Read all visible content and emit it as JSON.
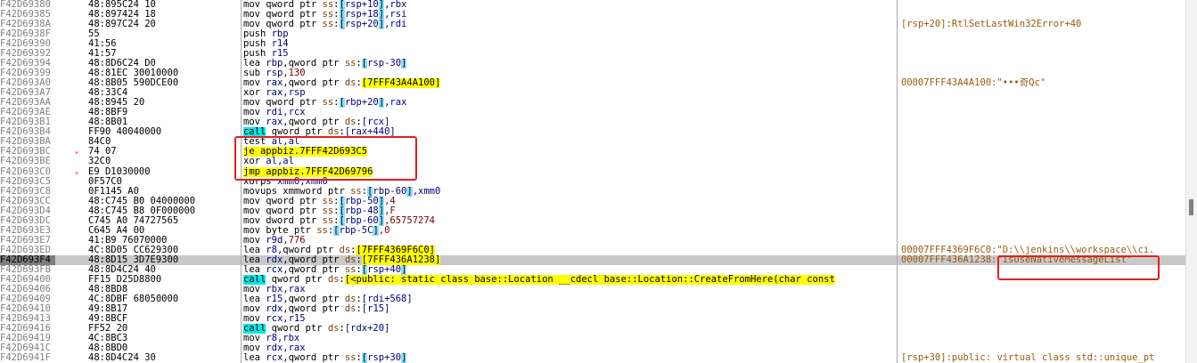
{
  "window": {
    "title": ""
  },
  "rows": [
    {
      "addr": "F42D69380",
      "arrow": "",
      "bytes": "48:895C24 10",
      "tokens": [
        {
          "t": "mov qword ptr ",
          "c": "mn"
        },
        {
          "t": "ss",
          "c": "seg"
        },
        {
          "t": ":",
          "c": "mn"
        },
        {
          "t": "[",
          "c": "rb"
        },
        {
          "t": "rsp+10",
          "c": "reg"
        },
        {
          "t": "]",
          "c": "rb"
        },
        {
          "t": ",rbx",
          "c": "reg"
        }
      ],
      "comment": ""
    },
    {
      "addr": "F42D69385",
      "arrow": "",
      "bytes": "48:897424 18",
      "tokens": [
        {
          "t": "mov qword ptr ",
          "c": "mn"
        },
        {
          "t": "ss",
          "c": "seg"
        },
        {
          "t": ":",
          "c": "mn"
        },
        {
          "t": "[",
          "c": "rb"
        },
        {
          "t": "rsp+18",
          "c": "reg"
        },
        {
          "t": "]",
          "c": "rb"
        },
        {
          "t": ",rsi",
          "c": "reg"
        }
      ],
      "comment": ""
    },
    {
      "addr": "F42D6938A",
      "arrow": "",
      "bytes": "48:897C24 20",
      "tokens": [
        {
          "t": "mov qword ptr ",
          "c": "mn"
        },
        {
          "t": "ss",
          "c": "seg"
        },
        {
          "t": ":",
          "c": "mn"
        },
        {
          "t": "[",
          "c": "rb"
        },
        {
          "t": "rsp+20",
          "c": "reg"
        },
        {
          "t": "]",
          "c": "rb"
        },
        {
          "t": ",rdi",
          "c": "reg"
        }
      ],
      "comment": "[rsp+20]:RtlSetLastWin32Error+40"
    },
    {
      "addr": "F42D6938F",
      "arrow": "",
      "bytes": "55",
      "tokens": [
        {
          "t": "push ",
          "c": "mn"
        },
        {
          "t": "rbp",
          "c": "reg"
        }
      ],
      "comment": ""
    },
    {
      "addr": "F42D69390",
      "arrow": "",
      "bytes": "41:56",
      "tokens": [
        {
          "t": "push ",
          "c": "mn"
        },
        {
          "t": "r14",
          "c": "reg"
        }
      ],
      "comment": ""
    },
    {
      "addr": "F42D69392",
      "arrow": "",
      "bytes": "41:57",
      "tokens": [
        {
          "t": "push ",
          "c": "mn"
        },
        {
          "t": "r15",
          "c": "reg"
        }
      ],
      "comment": ""
    },
    {
      "addr": "F42D69394",
      "arrow": "",
      "bytes": "48:8D6C24 D0",
      "tokens": [
        {
          "t": "lea ",
          "c": "mn"
        },
        {
          "t": "rbp",
          "c": "reg"
        },
        {
          "t": ",qword ptr ",
          "c": "mn"
        },
        {
          "t": "ss",
          "c": "seg"
        },
        {
          "t": ":",
          "c": "mn"
        },
        {
          "t": "[",
          "c": "rb"
        },
        {
          "t": "rsp-30",
          "c": "reg"
        },
        {
          "t": "]",
          "c": "rb"
        }
      ],
      "comment": ""
    },
    {
      "addr": "F42D69399",
      "arrow": "",
      "bytes": "48:81EC 30010000",
      "tokens": [
        {
          "t": "sub ",
          "c": "mn"
        },
        {
          "t": "rsp",
          "c": "reg"
        },
        {
          "t": ",130",
          "c": "imm"
        }
      ],
      "comment": ""
    },
    {
      "addr": "F42D693A0",
      "arrow": "",
      "bytes": "48:8B05 590DCE00",
      "tokens": [
        {
          "t": "mov ",
          "c": "mn"
        },
        {
          "t": "rax",
          "c": "reg"
        },
        {
          "t": ",qword ptr ",
          "c": "mn"
        },
        {
          "t": "ds",
          "c": "seg"
        },
        {
          "t": ":",
          "c": "mn"
        },
        {
          "t": "[7FFF43A4A100]",
          "c": "addr"
        }
      ],
      "comment": "00007FFF43A4A100:\"•••奇Qc\""
    },
    {
      "addr": "F42D693A7",
      "arrow": "",
      "bytes": "48:33C4",
      "tokens": [
        {
          "t": "xor ",
          "c": "mn"
        },
        {
          "t": "rax,rsp",
          "c": "reg"
        }
      ],
      "comment": ""
    },
    {
      "addr": "F42D693AA",
      "arrow": "",
      "bytes": "48:8945 20",
      "tokens": [
        {
          "t": "mov qword ptr ",
          "c": "mn"
        },
        {
          "t": "ss",
          "c": "seg"
        },
        {
          "t": ":",
          "c": "mn"
        },
        {
          "t": "[",
          "c": "rb"
        },
        {
          "t": "rbp+20",
          "c": "reg"
        },
        {
          "t": "]",
          "c": "rb"
        },
        {
          "t": ",rax",
          "c": "reg"
        }
      ],
      "comment": ""
    },
    {
      "addr": "F42D693AE",
      "arrow": "",
      "bytes": "48:8BF9",
      "tokens": [
        {
          "t": "mov ",
          "c": "mn"
        },
        {
          "t": "rdi,rcx",
          "c": "reg"
        }
      ],
      "comment": ""
    },
    {
      "addr": "F42D693B1",
      "arrow": "",
      "bytes": "48:8B01",
      "tokens": [
        {
          "t": "mov ",
          "c": "mn"
        },
        {
          "t": "rax",
          "c": "reg"
        },
        {
          "t": ",qword ptr ",
          "c": "mn"
        },
        {
          "t": "ds",
          "c": "seg"
        },
        {
          "t": ":",
          "c": "mn"
        },
        {
          "t": "[rcx]",
          "c": "reg"
        }
      ],
      "comment": ""
    },
    {
      "addr": "F42D693B4",
      "arrow": "",
      "bytes": "FF90 40040000",
      "tokens": [
        {
          "t": "call",
          "c": "call"
        },
        {
          "t": " qword ptr ",
          "c": "mn"
        },
        {
          "t": "ds",
          "c": "seg"
        },
        {
          "t": ":",
          "c": "mn"
        },
        {
          "t": "[rax+440]",
          "c": "reg"
        }
      ],
      "comment": ""
    },
    {
      "addr": "F42D693BA",
      "arrow": "",
      "bytes": "84C0",
      "tokens": [
        {
          "t": "test ",
          "c": "mn"
        },
        {
          "t": "al,al",
          "c": "reg"
        }
      ],
      "comment": ""
    },
    {
      "addr": "F42D693BC",
      "arrow": "⌄",
      "bytes": "74 07",
      "tokens": [
        {
          "t": "je appbiz.7FFF42D693C5",
          "c": "jmp"
        }
      ],
      "comment": ""
    },
    {
      "addr": "F42D693BE",
      "arrow": "",
      "bytes": "32C0",
      "tokens": [
        {
          "t": "xor ",
          "c": "mn"
        },
        {
          "t": "al,al",
          "c": "reg"
        }
      ],
      "comment": ""
    },
    {
      "addr": "F42D693C0",
      "arrow": "⌄",
      "bytes": "E9 D1030000",
      "tokens": [
        {
          "t": "jmp appbiz.7FFF42D69796",
          "c": "jmp"
        }
      ],
      "comment": ""
    },
    {
      "addr": "F42D693C5",
      "arrow": "",
      "bytes": "0F57C0",
      "tokens": [
        {
          "t": "xorps ",
          "c": "mn"
        },
        {
          "t": "xmm0,xmm0",
          "c": "reg"
        }
      ],
      "comment": ""
    },
    {
      "addr": "F42D693C8",
      "arrow": "",
      "bytes": "0F1145 A0",
      "tokens": [
        {
          "t": "movups xmmword ptr ",
          "c": "mn"
        },
        {
          "t": "ss",
          "c": "seg"
        },
        {
          "t": ":",
          "c": "mn"
        },
        {
          "t": "[",
          "c": "rb"
        },
        {
          "t": "rbp-60",
          "c": "reg"
        },
        {
          "t": "]",
          "c": "rb"
        },
        {
          "t": ",xmm0",
          "c": "reg"
        }
      ],
      "comment": ""
    },
    {
      "addr": "F42D693CC",
      "arrow": "",
      "bytes": "48:C745 B0 04000000",
      "tokens": [
        {
          "t": "mov qword ptr ",
          "c": "mn"
        },
        {
          "t": "ss",
          "c": "seg"
        },
        {
          "t": ":",
          "c": "mn"
        },
        {
          "t": "[",
          "c": "rb"
        },
        {
          "t": "rbp-50",
          "c": "reg"
        },
        {
          "t": "]",
          "c": "rb"
        },
        {
          "t": ",4",
          "c": "imm"
        }
      ],
      "comment": ""
    },
    {
      "addr": "F42D693D4",
      "arrow": "",
      "bytes": "48:C745 B8 0F000000",
      "tokens": [
        {
          "t": "mov qword ptr ",
          "c": "mn"
        },
        {
          "t": "ss",
          "c": "seg"
        },
        {
          "t": ":",
          "c": "mn"
        },
        {
          "t": "[",
          "c": "rb"
        },
        {
          "t": "rbp-48",
          "c": "reg"
        },
        {
          "t": "]",
          "c": "rb"
        },
        {
          "t": ",F",
          "c": "imm"
        }
      ],
      "comment": ""
    },
    {
      "addr": "F42D693DC",
      "arrow": "",
      "bytes": "C745 A0 74727565",
      "tokens": [
        {
          "t": "mov dword ptr ",
          "c": "mn"
        },
        {
          "t": "ss",
          "c": "seg"
        },
        {
          "t": ":",
          "c": "mn"
        },
        {
          "t": "[",
          "c": "rb"
        },
        {
          "t": "rbp-60",
          "c": "reg"
        },
        {
          "t": "]",
          "c": "rb"
        },
        {
          "t": ",65757274",
          "c": "imm"
        }
      ],
      "comment": ""
    },
    {
      "addr": "F42D693E3",
      "arrow": "",
      "bytes": "C645 A4 00",
      "tokens": [
        {
          "t": "mov byte ptr ",
          "c": "mn"
        },
        {
          "t": "ss",
          "c": "seg"
        },
        {
          "t": ":",
          "c": "mn"
        },
        {
          "t": "[",
          "c": "rb"
        },
        {
          "t": "rbp-5C",
          "c": "reg"
        },
        {
          "t": "]",
          "c": "rb"
        },
        {
          "t": ",0",
          "c": "imm"
        }
      ],
      "comment": ""
    },
    {
      "addr": "F42D693E7",
      "arrow": "",
      "bytes": "41:B9 76070000",
      "tokens": [
        {
          "t": "mov ",
          "c": "mn"
        },
        {
          "t": "r9d",
          "c": "reg"
        },
        {
          "t": ",776",
          "c": "imm"
        }
      ],
      "comment": ""
    },
    {
      "addr": "F42D693ED",
      "arrow": "",
      "bytes": "4C:8D05 CC629300",
      "tokens": [
        {
          "t": "lea ",
          "c": "mn"
        },
        {
          "t": "r8",
          "c": "reg"
        },
        {
          "t": ",qword ptr ",
          "c": "mn"
        },
        {
          "t": "ds",
          "c": "seg"
        },
        {
          "t": ":",
          "c": "mn"
        },
        {
          "t": "[7FFF4369F6C0]",
          "c": "addr"
        }
      ],
      "comment": "00007FFF4369F6C0:\"D:\\\\jenkins\\\\workspace\\\\ci."
    },
    {
      "addr": "F42D693F4",
      "arrow": "",
      "bytes": "48:8D15 3D7E9300",
      "tokens": [
        {
          "t": "lea ",
          "c": "mn"
        },
        {
          "t": "rdx",
          "c": "reg"
        },
        {
          "t": ",qword ptr ",
          "c": "mn"
        },
        {
          "t": "ds",
          "c": "seg"
        },
        {
          "t": ":",
          "c": "mn"
        },
        {
          "t": "[7FFF436A1238]",
          "c": "addr"
        }
      ],
      "comment": "00007FFF436A1238:\"IsUseNativeMessageList\"",
      "hl": true
    },
    {
      "addr": "F42D693FB",
      "arrow": "",
      "bytes": "48:8D4C24 40",
      "tokens": [
        {
          "t": "lea ",
          "c": "mn"
        },
        {
          "t": "rcx",
          "c": "reg"
        },
        {
          "t": ",qword ptr ",
          "c": "mn"
        },
        {
          "t": "ss",
          "c": "seg"
        },
        {
          "t": ":",
          "c": "mn"
        },
        {
          "t": "[",
          "c": "rb"
        },
        {
          "t": "rsp+40",
          "c": "reg"
        },
        {
          "t": "]",
          "c": "rb"
        }
      ],
      "comment": ""
    },
    {
      "addr": "F42D69400",
      "arrow": "",
      "bytes": "FF15 D25D8800",
      "tokens": [
        {
          "t": "call",
          "c": "call"
        },
        {
          "t": " qword ptr ",
          "c": "mn"
        },
        {
          "t": "ds",
          "c": "seg"
        },
        {
          "t": ":",
          "c": "mn"
        },
        {
          "t": "[<public: static class base::Location __cdecl base::Location::CreateFromHere(char const",
          "c": "addr"
        }
      ],
      "comment": ""
    },
    {
      "addr": "F42D69406",
      "arrow": "",
      "bytes": "48:8BD8",
      "tokens": [
        {
          "t": "mov ",
          "c": "mn"
        },
        {
          "t": "rbx,rax",
          "c": "reg"
        }
      ],
      "comment": ""
    },
    {
      "addr": "F42D69409",
      "arrow": "",
      "bytes": "4C:8DBF 68050000",
      "tokens": [
        {
          "t": "lea ",
          "c": "mn"
        },
        {
          "t": "r15",
          "c": "reg"
        },
        {
          "t": ",qword ptr ",
          "c": "mn"
        },
        {
          "t": "ds",
          "c": "seg"
        },
        {
          "t": ":",
          "c": "mn"
        },
        {
          "t": "[rdi+568]",
          "c": "reg"
        }
      ],
      "comment": ""
    },
    {
      "addr": "F42D69410",
      "arrow": "",
      "bytes": "49:8B17",
      "tokens": [
        {
          "t": "mov ",
          "c": "mn"
        },
        {
          "t": "rdx",
          "c": "reg"
        },
        {
          "t": ",qword ptr ",
          "c": "mn"
        },
        {
          "t": "ds",
          "c": "seg"
        },
        {
          "t": ":",
          "c": "mn"
        },
        {
          "t": "[r15]",
          "c": "reg"
        }
      ],
      "comment": ""
    },
    {
      "addr": "F42D69413",
      "arrow": "",
      "bytes": "49:8BCF",
      "tokens": [
        {
          "t": "mov ",
          "c": "mn"
        },
        {
          "t": "rcx,r15",
          "c": "reg"
        }
      ],
      "comment": ""
    },
    {
      "addr": "F42D69416",
      "arrow": "",
      "bytes": "FF52 20",
      "tokens": [
        {
          "t": "call",
          "c": "call"
        },
        {
          "t": " qword ptr ",
          "c": "mn"
        },
        {
          "t": "ds",
          "c": "seg"
        },
        {
          "t": ":",
          "c": "mn"
        },
        {
          "t": "[rdx+20]",
          "c": "reg"
        }
      ],
      "comment": ""
    },
    {
      "addr": "F42D69419",
      "arrow": "",
      "bytes": "4C:8BC3",
      "tokens": [
        {
          "t": "mov ",
          "c": "mn"
        },
        {
          "t": "r8,rbx",
          "c": "reg"
        }
      ],
      "comment": ""
    },
    {
      "addr": "F42D6941C",
      "arrow": "",
      "bytes": "48:8BD0",
      "tokens": [
        {
          "t": "mov ",
          "c": "mn"
        },
        {
          "t": "rdx,rax",
          "c": "reg"
        }
      ],
      "comment": ""
    },
    {
      "addr": "F42D6941F",
      "arrow": "",
      "bytes": "48:8D4C24 30",
      "tokens": [
        {
          "t": "lea ",
          "c": "mn"
        },
        {
          "t": "rcx",
          "c": "reg"
        },
        {
          "t": ",qword ptr ",
          "c": "mn"
        },
        {
          "t": "ss",
          "c": "seg"
        },
        {
          "t": ":",
          "c": "mn"
        },
        {
          "t": "[",
          "c": "rb"
        },
        {
          "t": "rsp+30",
          "c": "reg"
        },
        {
          "t": "]",
          "c": "rb"
        }
      ],
      "comment": "[rsp+30]:public: virtual class std::unique_pt"
    }
  ],
  "colors": {
    "highlight_row": "#c9c9c9",
    "annotation_red": "#e02020",
    "jump_target": "#ffff00",
    "call_mnemonic": "#00e8e8"
  }
}
